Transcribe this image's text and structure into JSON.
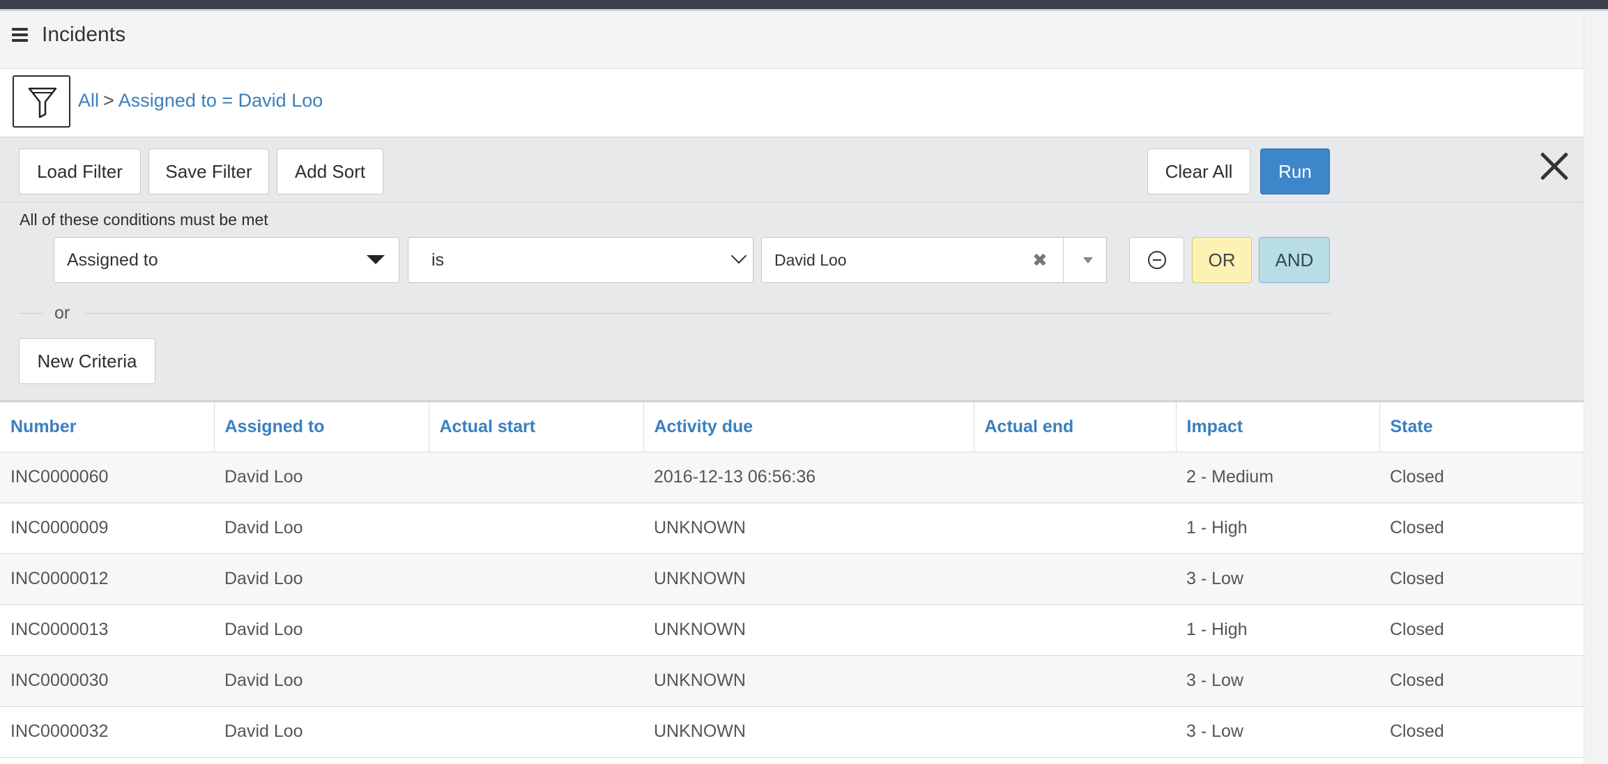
{
  "header": {
    "title": "Incidents"
  },
  "breadcrumb": {
    "all": "All",
    "separator": ">",
    "condition": "Assigned to = David Loo"
  },
  "toolbar": {
    "load_filter": "Load Filter",
    "save_filter": "Save Filter",
    "add_sort": "Add Sort",
    "clear_all": "Clear All",
    "run": "Run"
  },
  "conditions": {
    "label": "All of these conditions must be met",
    "field": "Assigned to",
    "operator": "is",
    "value": "David Loo",
    "clear_glyph": "✖",
    "or_button": "OR",
    "and_button": "AND",
    "or_separator": "or",
    "new_criteria": "New Criteria"
  },
  "table": {
    "columns": [
      "Number",
      "Assigned to",
      "Actual start",
      "Activity due",
      "Actual end",
      "Impact",
      "State"
    ],
    "rows": [
      [
        "INC0000060",
        "David Loo",
        "",
        "2016-12-13 06:56:36",
        "",
        "2 - Medium",
        "Closed"
      ],
      [
        "INC0000009",
        "David Loo",
        "",
        "UNKNOWN",
        "",
        "1 - High",
        "Closed"
      ],
      [
        "INC0000012",
        "David Loo",
        "",
        "UNKNOWN",
        "",
        "3 - Low",
        "Closed"
      ],
      [
        "INC0000013",
        "David Loo",
        "",
        "UNKNOWN",
        "",
        "1 - High",
        "Closed"
      ],
      [
        "INC0000030",
        "David Loo",
        "",
        "UNKNOWN",
        "",
        "3 - Low",
        "Closed"
      ],
      [
        "INC0000032",
        "David Loo",
        "",
        "UNKNOWN",
        "",
        "3 - Low",
        "Closed"
      ]
    ]
  },
  "colors": {
    "link": "#3a7fc0",
    "run_button": "#3d86c9",
    "or_button": "#fbf2b4",
    "and_button": "#b9dde6"
  }
}
